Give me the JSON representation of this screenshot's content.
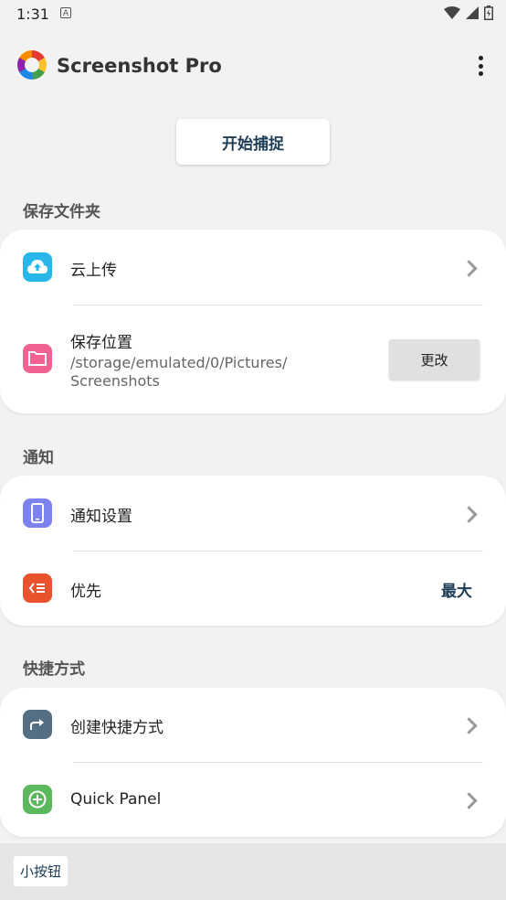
{
  "status_bar": {
    "time": "1:31",
    "notification_glyph": "A"
  },
  "app": {
    "title": "Screenshot Pro"
  },
  "capture_button": "开始捕捉",
  "sections": {
    "save_folder": {
      "title": "保存文件夹",
      "cloud_upload": "云上传",
      "save_location": "保存位置",
      "path_line1": "/storage/emulated/0/Pictures/",
      "path_line2": "Screenshots",
      "change_button": "更改"
    },
    "notification": {
      "title": "通知",
      "notification_settings": "通知设置",
      "priority": "优先",
      "priority_value": "最大"
    },
    "shortcut": {
      "title": "快捷方式",
      "create_shortcut": "创建快捷方式",
      "quick_panel": "Quick Panel"
    }
  },
  "bottom": {
    "mini_button": "小按钮"
  },
  "colors": {
    "accent_text": "#1d3c55",
    "cloud_icon": "#29b6e8",
    "folder_icon": "#f06292",
    "phone_icon": "#7c83f0",
    "priority_icon": "#e8532e",
    "shortcut_icon": "#546e84",
    "panel_icon": "#5cb85c"
  },
  "icons": [
    "cloud-upload-icon",
    "folder-icon",
    "phone-icon",
    "priority-icon",
    "share-arrow-icon",
    "add-circle-icon"
  ]
}
